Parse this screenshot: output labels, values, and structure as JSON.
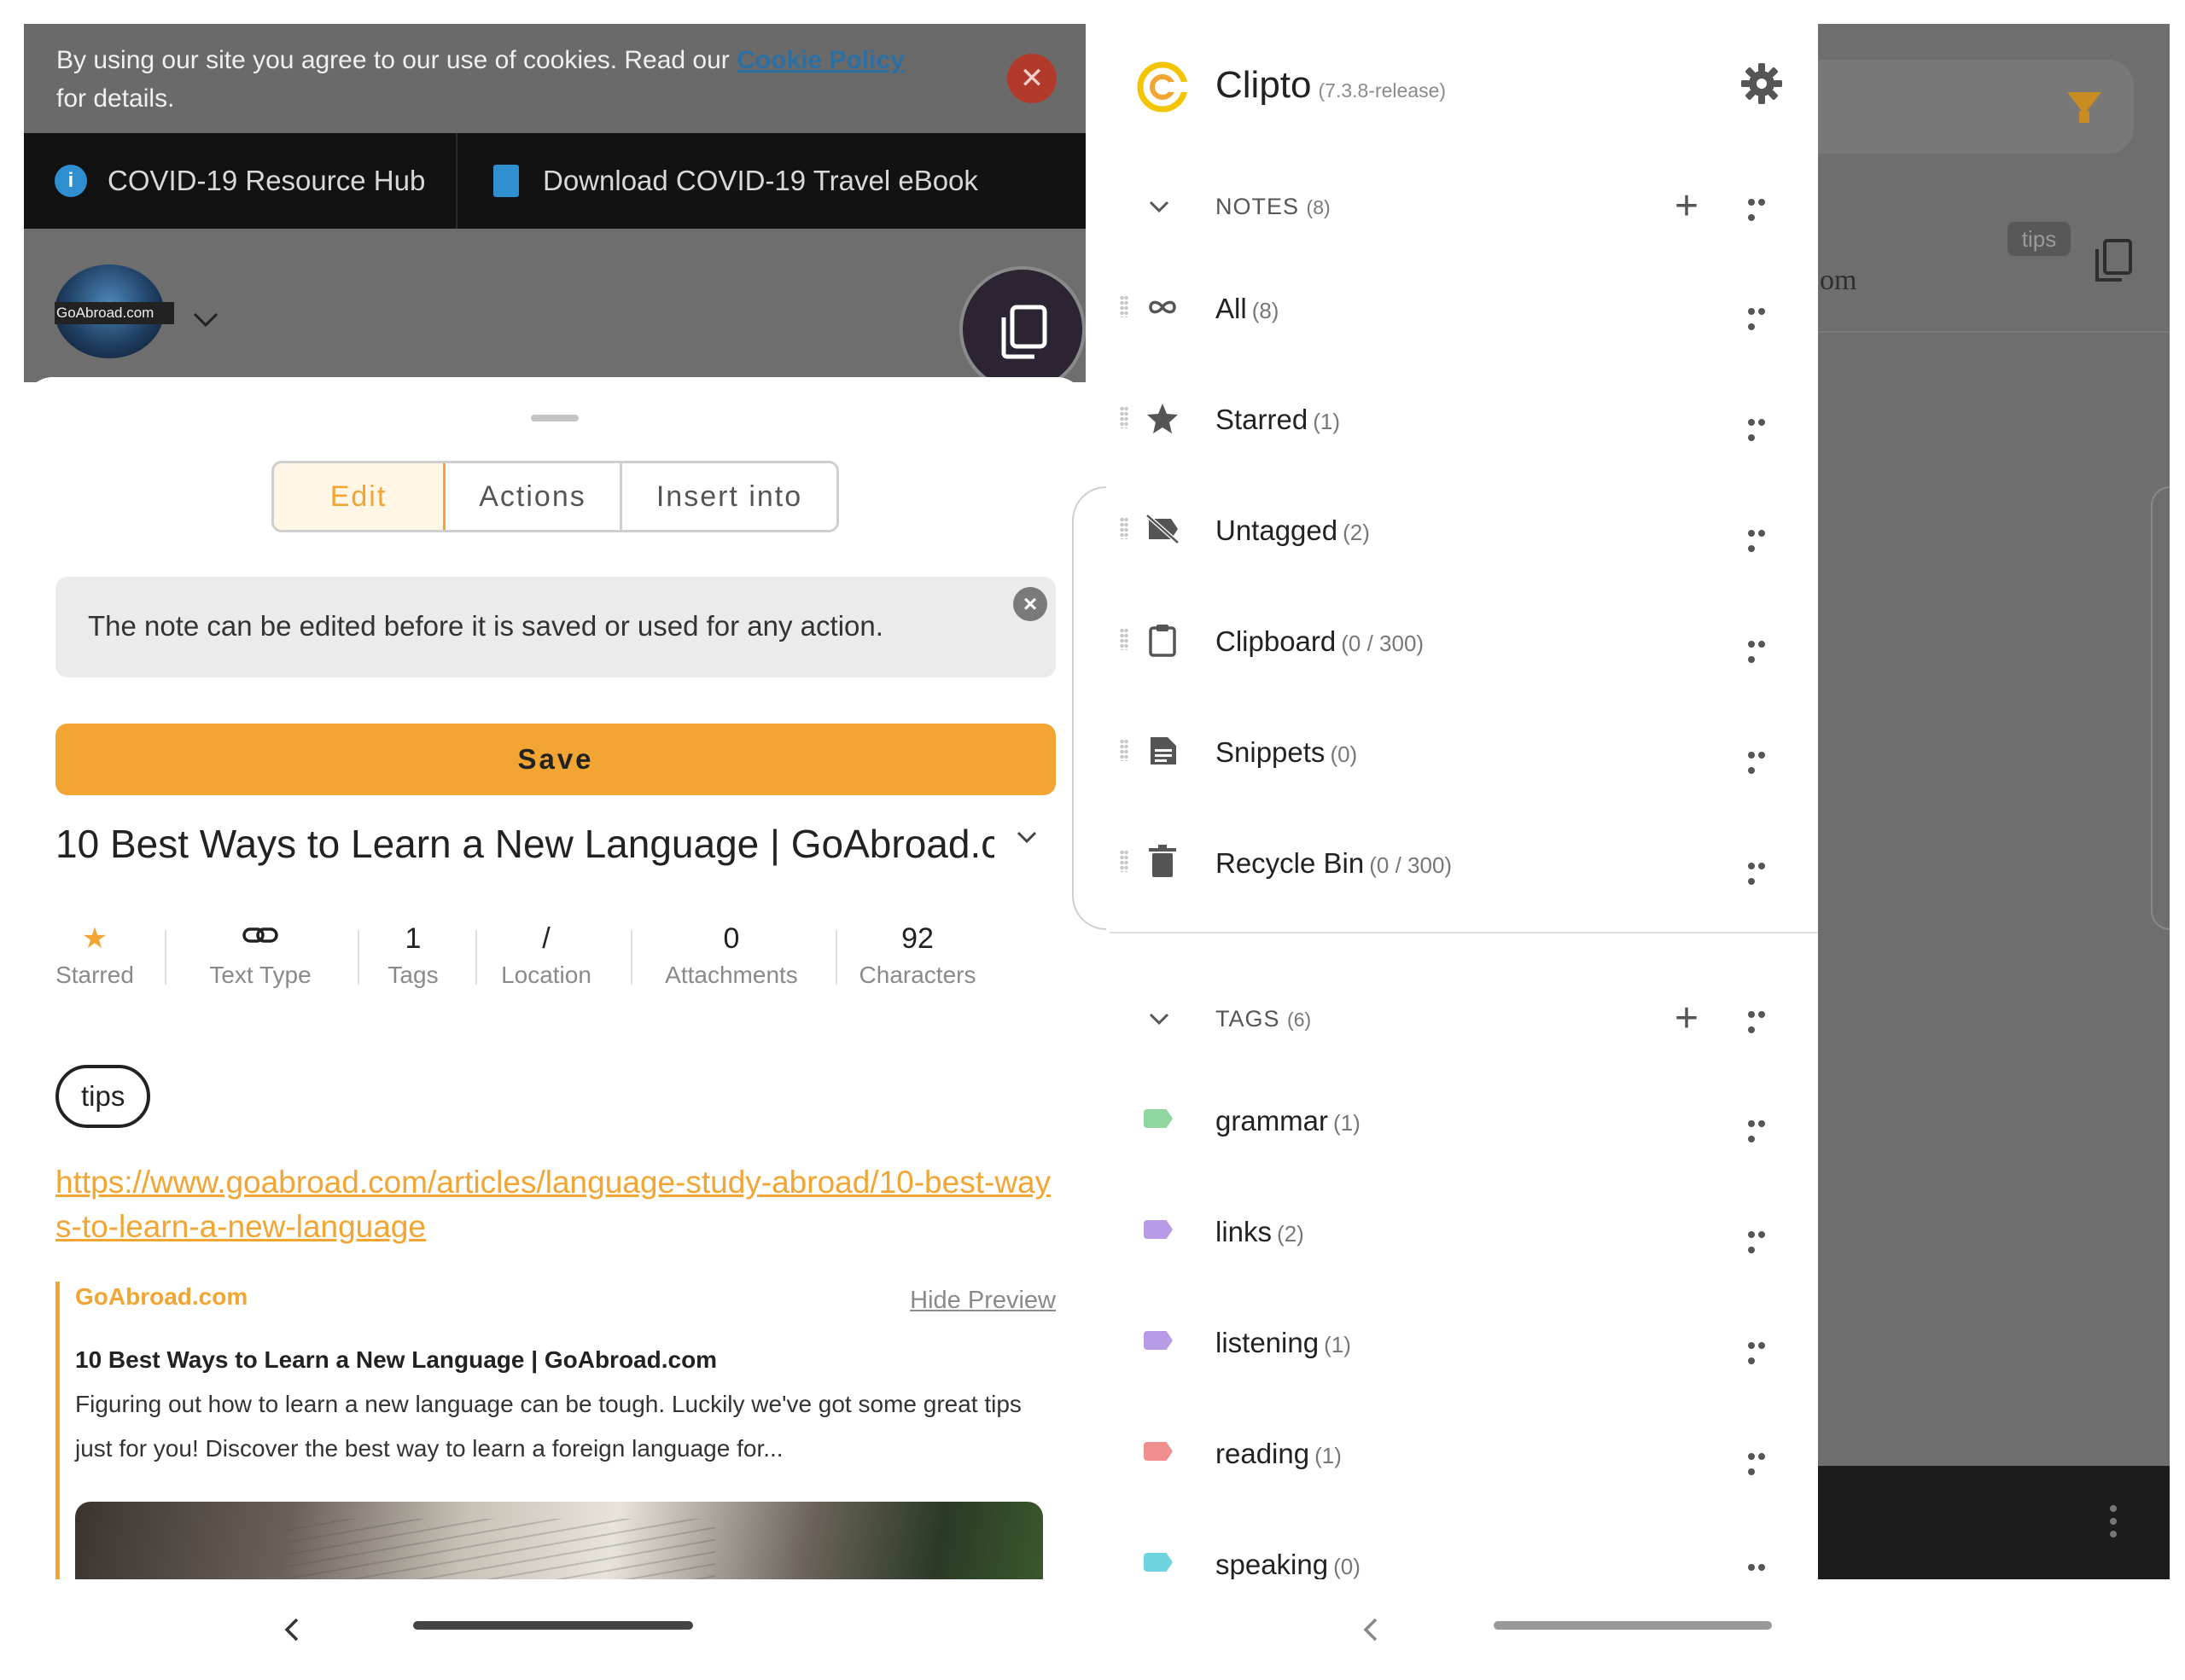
{
  "left": {
    "cookie": {
      "text": "By using our site you agree to our use of cookies. Read our",
      "link": "Cookie Policy",
      "text2": "for details.",
      "close": "✕"
    },
    "covid": {
      "item1": "COVID-19 Resource Hub",
      "item2": "Download COVID-19 Travel eBook"
    },
    "site_logo": "GoAbroad.com",
    "tabs": [
      "Edit",
      "Actions",
      "Insert into"
    ],
    "info_text": "The note can be edited before it is saved or used for any action.",
    "save_label": "Save",
    "note_title": "10 Best Ways to Learn a New Language | GoAbroad.com",
    "stats": [
      {
        "value": "★",
        "label": "Starred"
      },
      {
        "value": "🔗",
        "label": "Text Type"
      },
      {
        "value": "1",
        "label": "Tags"
      },
      {
        "value": "/",
        "label": "Location"
      },
      {
        "value": "0",
        "label": "Attachments"
      },
      {
        "value": "92",
        "label": "Characters"
      }
    ],
    "tag": "tips",
    "url": "https://www.goabroad.com/articles/language-study-abroad/10-best-ways-to-learn-a-new-language",
    "preview": {
      "site": "GoAbroad.com",
      "hide": "Hide Preview",
      "title": "10 Best Ways to Learn a New Language | GoAbroad.com",
      "desc": "Figuring out how to learn a new language can be tough. Luckily we've got some great tips just for you! Discover the best way to learn a foreign language for..."
    }
  },
  "drawer": {
    "app_name": "Clipto",
    "version": "(7.3.8-release)",
    "notes_header": "NOTES",
    "notes_count": "(8)",
    "notes": [
      {
        "name": "All",
        "count": "(8)",
        "icon": "infinity-icon"
      },
      {
        "name": "Starred",
        "count": "(1)",
        "icon": "star-icon"
      },
      {
        "name": "Untagged",
        "count": "(2)",
        "icon": "untagged-icon"
      },
      {
        "name": "Clipboard",
        "count": "(0 / 300)",
        "icon": "clipboard-icon"
      },
      {
        "name": "Snippets",
        "count": "(0)",
        "icon": "snippets-icon"
      },
      {
        "name": "Recycle Bin",
        "count": "(0 / 300)",
        "icon": "trash-icon"
      }
    ],
    "tags_header": "TAGS",
    "tags_count": "(6)",
    "tags": [
      {
        "name": "grammar",
        "count": "(1)",
        "color": "#8fd6a0"
      },
      {
        "name": "links",
        "count": "(2)",
        "color": "#b79be6"
      },
      {
        "name": "listening",
        "count": "(1)",
        "color": "#b79be6"
      },
      {
        "name": "reading",
        "count": "(1)",
        "color": "#ef8f8f"
      },
      {
        "name": "speaking",
        "count": "(0)",
        "color": "#6fd3e0"
      }
    ]
  },
  "behind": {
    "tips_badge": "tips",
    "partial_text": "om"
  },
  "colors": {
    "accent": "#f2a532",
    "dim_overlay": "#6e6e6e"
  }
}
